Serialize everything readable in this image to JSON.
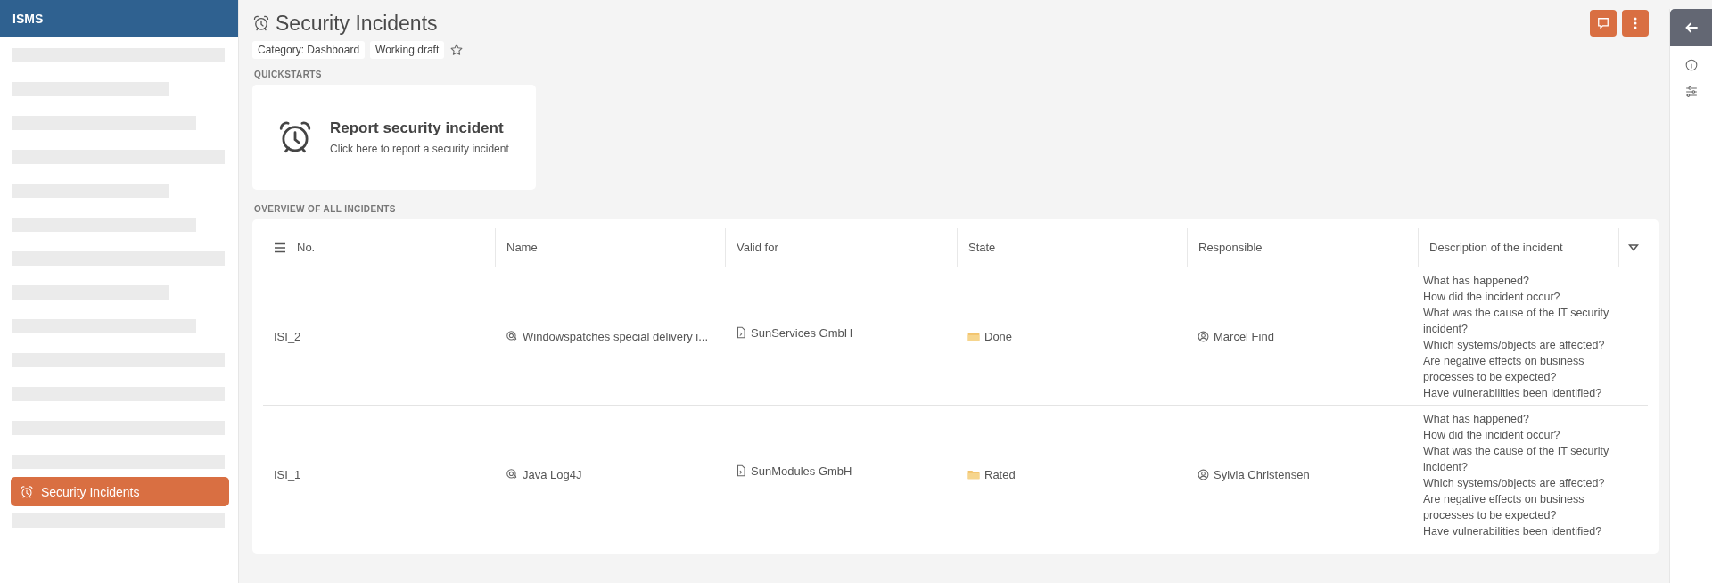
{
  "sidebar": {
    "title": "ISMS",
    "items": [
      {
        "kind": "placeholder"
      },
      {
        "kind": "placeholder"
      },
      {
        "kind": "placeholder"
      },
      {
        "kind": "placeholder"
      },
      {
        "kind": "placeholder"
      },
      {
        "kind": "placeholder"
      },
      {
        "kind": "placeholder"
      },
      {
        "kind": "placeholder"
      },
      {
        "kind": "placeholder"
      },
      {
        "kind": "placeholder"
      },
      {
        "kind": "placeholder"
      },
      {
        "kind": "placeholder"
      },
      {
        "kind": "placeholder"
      },
      {
        "kind": "link",
        "label": "Security Incidents",
        "selected": true
      },
      {
        "kind": "placeholder"
      }
    ]
  },
  "page": {
    "title": "Security Incidents",
    "tags": [
      "Category: Dashboard",
      "Working draft"
    ],
    "favorite": false
  },
  "quickstarts": {
    "heading": "QUICKSTARTS",
    "cards": [
      {
        "title": "Report security incident",
        "description": "Click here to report a security incident"
      }
    ]
  },
  "table": {
    "heading": "OVERVIEW OF ALL INCIDENTS",
    "columns": [
      "No.",
      "Name",
      "Valid for",
      "State",
      "Responsible",
      "Description of the incident"
    ],
    "rows": [
      {
        "no": "ISI_2",
        "name": "Windowspatches special delivery i...",
        "valid_for": "SunServices GmbH",
        "state": "Done",
        "responsible": "Marcel Find",
        "description": [
          "What has happened?",
          "How did the incident occur?",
          "What was the cause of the IT security incident?",
          "Which systems/objects are affected?",
          "Are negative effects on business processes to be expected?",
          "Have vulnerabilities been identified?"
        ]
      },
      {
        "no": "ISI_1",
        "name": "Java Log4J",
        "valid_for": "SunModules GmbH",
        "state": "Rated",
        "responsible": "Sylvia Christensen",
        "description": [
          "What has happened?",
          "How did the incident occur?",
          "What was the cause of the IT security incident?",
          "Which systems/objects are affected?",
          "Are negative effects on business processes to be expected?",
          "Have vulnerabilities been identified?"
        ]
      }
    ]
  }
}
